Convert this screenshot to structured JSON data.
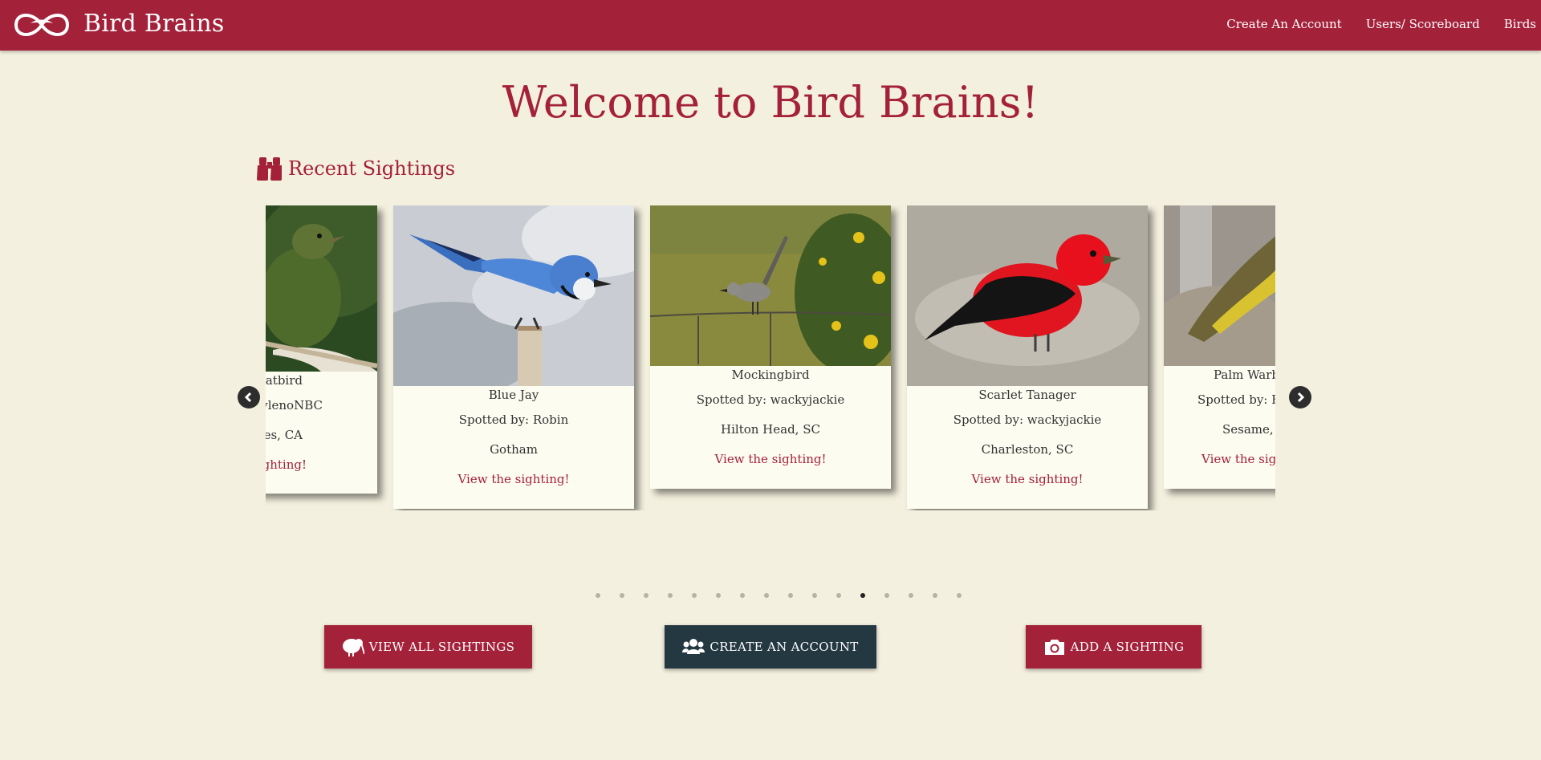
{
  "header": {
    "brand": "Bird Brains",
    "nav": [
      "Create An Account",
      "Users/ Scoreboard",
      "Birds"
    ]
  },
  "main": {
    "welcome": "Welcome to Bird Brains!",
    "recent_heading": "Recent Sightings"
  },
  "cards": [
    {
      "name": "Catbird",
      "spotted": "Spotted by: ylenoNBC",
      "location": "Los Angeles, CA",
      "link": "View the sighting!",
      "shown_name": "atbird",
      "shown_spotted": "ylenoNBC",
      "shown_location": "es, CA",
      "shown_link": "ghting!"
    },
    {
      "name": "Blue Jay",
      "spotted": "Spotted by: Robin",
      "location": "Gotham",
      "link": "View the sighting!"
    },
    {
      "name": "Mockingbird",
      "spotted": "Spotted by: wackyjackie",
      "location": "Hilton Head, SC",
      "link": "View the sighting!"
    },
    {
      "name": "Scarlet Tanager",
      "spotted": "Spotted by: wackyjackie",
      "location": "Charleston, SC",
      "link": "View the sighting!"
    },
    {
      "name": "Palm Warbler",
      "shown_name": "Palm Warb",
      "shown_spotted": "Spotted by: Bi",
      "shown_location": "Sesame, S",
      "shown_link": "View the sigh"
    }
  ],
  "carousel": {
    "page_count": 16,
    "active_index": 11
  },
  "buttons": {
    "view_all": "VIEW ALL SIGHTINGS",
    "create_account": "CREATE AN ACCOUNT",
    "add_sighting": "ADD A SIGHTING"
  },
  "icons": {
    "logo": "infinity-bird-logo-icon",
    "binoculars": "binoculars-icon",
    "kiwi": "kiwi-bird-icon",
    "users": "users-icon",
    "camera": "camera-icon",
    "prev": "chevron-left-icon",
    "next": "chevron-right-icon"
  },
  "colors": {
    "brand": "#a4213a",
    "background": "#f4f0df",
    "card": "#fdfcf0",
    "dark_button": "#243842"
  }
}
